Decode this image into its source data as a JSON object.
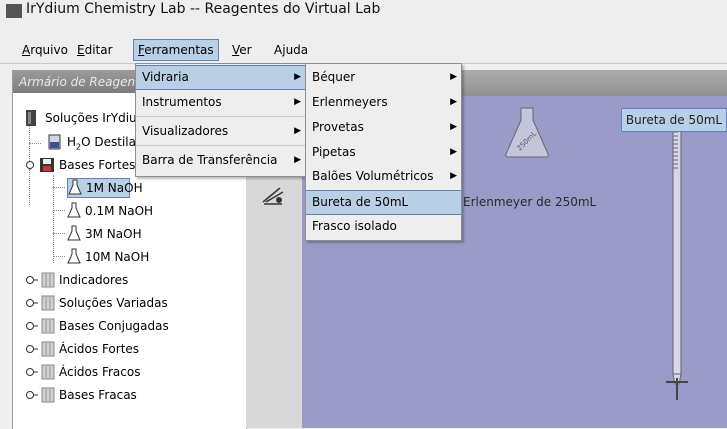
{
  "window": {
    "title": "IrYdium Chemistry Lab -- Reagentes do Virtual Lab"
  },
  "menubar": [
    {
      "label": "Arquivo",
      "mnemonic": "A",
      "rest": "rquivo"
    },
    {
      "label": "Editar",
      "mnemonic": "E",
      "rest": "ditar"
    },
    {
      "label": "Ferramentas",
      "mnemonic": "F",
      "rest": "erramentas",
      "active": true
    },
    {
      "label": "Ver",
      "mnemonic": "V",
      "rest": "er"
    },
    {
      "label": "Ajuda",
      "pre": "A",
      "mnemonic": "j",
      "rest": "uda"
    }
  ],
  "left_panel": {
    "header": "Armário de Reagentes",
    "tree": [
      {
        "label": "Soluções IrYdium",
        "level": 0,
        "icon": "bottle-icon"
      },
      {
        "label_pre": "H",
        "label_sub": "2",
        "label_post": "O Destilada",
        "level": 1,
        "icon": "beaker-icon"
      },
      {
        "label": "Bases Fortes",
        "level": 1,
        "icon": "folder-icon",
        "expanded": true
      },
      {
        "label": "1M NaOH",
        "level": 2,
        "icon": "flask-icon",
        "selected": true
      },
      {
        "label": "0.1M NaOH",
        "level": 2,
        "icon": "flask-icon"
      },
      {
        "label": "3M NaOH",
        "level": 2,
        "icon": "flask-icon"
      },
      {
        "label": "10M NaOH",
        "level": 2,
        "icon": "flask-icon"
      },
      {
        "label": "Indicadores",
        "level": 0,
        "icon": "folder-icon"
      },
      {
        "label": "Soluções Variadas",
        "level": 0,
        "icon": "folder-icon"
      },
      {
        "label": "Bases Conjugadas",
        "level": 0,
        "icon": "folder-icon"
      },
      {
        "label": "Ácidos Fortes",
        "level": 0,
        "icon": "folder-icon"
      },
      {
        "label": "Ácidos Fracos",
        "level": 0,
        "icon": "folder-icon"
      },
      {
        "label": "Bases Fracas",
        "level": 0,
        "icon": "folder-icon"
      }
    ]
  },
  "menu_ferramentas": [
    {
      "label": "Vidraria",
      "has_submenu": true,
      "selected": true
    },
    {
      "label": "Instrumentos",
      "has_submenu": true
    },
    {
      "label": "Visualizadores",
      "has_submenu": true
    },
    {
      "label": "Barra de Transferência",
      "has_submenu": true
    }
  ],
  "menu_vidraria": [
    {
      "label": "Béquer",
      "has_submenu": true
    },
    {
      "label": "Erlenmeyers",
      "has_submenu": true
    },
    {
      "label": "Provetas",
      "has_submenu": true
    },
    {
      "label": "Pipetas",
      "has_submenu": true
    },
    {
      "label": "Balões Volumétricos",
      "has_submenu": true
    },
    {
      "label": "Bureta de 50mL",
      "selected": true
    },
    {
      "label": "Frasco isolado"
    }
  ],
  "workspace": {
    "erlenmeyer_label": "Erlenmeyer de 250mL",
    "flask_text": "250mL",
    "bureta_label": "Bureta de 50mL"
  },
  "colors": {
    "workspace_bg": "#9b9bc9",
    "selection": "#b8cfe5",
    "selection_border": "#6382bf"
  }
}
